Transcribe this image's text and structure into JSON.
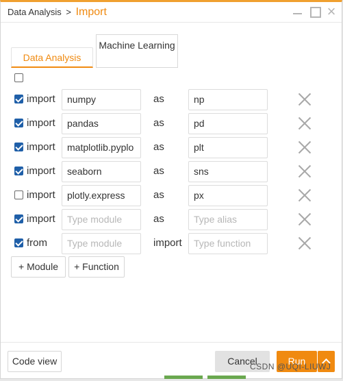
{
  "header": {
    "breadcrumb_parent": "Data Analysis",
    "breadcrumb_separator": ">",
    "breadcrumb_current": "Import",
    "close_glyph": "×"
  },
  "tabs": [
    {
      "label": "Data Analysis",
      "active": true
    },
    {
      "label": "Machine Learning",
      "active": false
    }
  ],
  "select_all_checked": false,
  "rows": [
    {
      "checked": true,
      "keyword": "import",
      "module": "numpy",
      "module_placeholder": "",
      "joiner": "as",
      "alias": "np",
      "alias_placeholder": ""
    },
    {
      "checked": true,
      "keyword": "import",
      "module": "pandas",
      "module_placeholder": "",
      "joiner": "as",
      "alias": "pd",
      "alias_placeholder": ""
    },
    {
      "checked": true,
      "keyword": "import",
      "module": "matplotlib.pyplo",
      "module_placeholder": "",
      "joiner": "as",
      "alias": "plt",
      "alias_placeholder": ""
    },
    {
      "checked": true,
      "keyword": "import",
      "module": "seaborn",
      "module_placeholder": "",
      "joiner": "as",
      "alias": "sns",
      "alias_placeholder": ""
    },
    {
      "checked": false,
      "keyword": "import",
      "module": "plotly.express",
      "module_placeholder": "",
      "joiner": "as",
      "alias": "px",
      "alias_placeholder": ""
    },
    {
      "checked": true,
      "keyword": "import",
      "module": "",
      "module_placeholder": "Type module",
      "joiner": "as",
      "alias": "",
      "alias_placeholder": "Type alias"
    },
    {
      "checked": true,
      "keyword": "from",
      "module": "",
      "module_placeholder": "Type module",
      "joiner": "import",
      "alias": "",
      "alias_placeholder": "Type function"
    }
  ],
  "add_buttons": {
    "module": "+ Module",
    "function": "+ Function"
  },
  "footer": {
    "code_view": "Code view",
    "cancel": "Cancel",
    "run": "Run"
  },
  "watermark": "CSDN @UQI-LIUWJ",
  "colors": {
    "accent": "#f08a10",
    "checkbox": "#1f5fa8",
    "cancel_bg": "#e2e2e2"
  },
  "icons": {
    "delete": "close-icon",
    "minimize": "minimize-icon",
    "maximize": "maximize-icon",
    "run_dropdown": "chevron-up-icon"
  }
}
